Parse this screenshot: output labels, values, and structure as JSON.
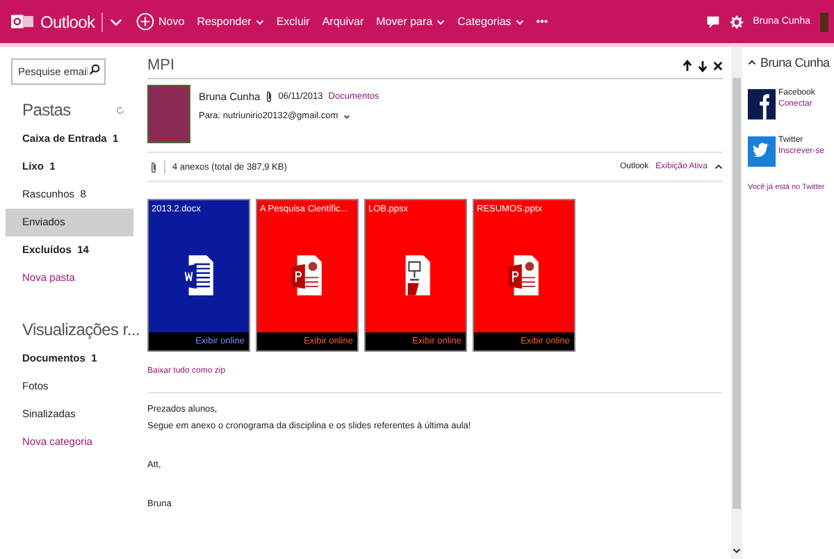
{
  "app": {
    "name": "Outlook"
  },
  "toolbar": {
    "new_label": "Novo",
    "actions": [
      {
        "label": "Responder",
        "dropdown": true
      },
      {
        "label": "Excluir",
        "dropdown": false
      },
      {
        "label": "Arquivar",
        "dropdown": false
      },
      {
        "label": "Mover para",
        "dropdown": true
      },
      {
        "label": "Categorias",
        "dropdown": true
      },
      {
        "label": "•••",
        "dropdown": false
      }
    ]
  },
  "user": {
    "name": "Bruna Cunha"
  },
  "search": {
    "placeholder": "Pesquise email"
  },
  "folders": {
    "title": "Pastas",
    "items": [
      {
        "label": "Caixa de Entrada",
        "count": "1",
        "unread": true,
        "selected": false
      },
      {
        "label": "Lixo",
        "count": "1",
        "unread": true,
        "selected": false
      },
      {
        "label": "Rascunhos",
        "count": "8",
        "unread": false,
        "selected": false
      },
      {
        "label": "Enviados",
        "unread": false,
        "selected": true
      },
      {
        "label": "Excluídos",
        "count": "14",
        "unread": true,
        "selected": false
      }
    ],
    "new_link": "Nova pasta"
  },
  "views": {
    "title": "Visualizações r...",
    "items": [
      {
        "label": "Documentos",
        "count": "1",
        "unread": true,
        "selected": false
      },
      {
        "label": "Fotos",
        "unread": false,
        "selected": false
      },
      {
        "label": "Sinalizadas",
        "unread": false,
        "selected": false
      }
    ],
    "new_link": "Nova categoria"
  },
  "message": {
    "subject": "MPI",
    "sender": "Bruna Cunha",
    "date": "06/11/2013",
    "category": "Documentos",
    "to": "Para: nutriunirio20132@gmail.com",
    "attachments_summary": "4 anexos (total de 387,9 KB)",
    "view_prefix": "Outlook",
    "view_link": "Exibição Ativa",
    "attachments": [
      {
        "name": "2013.2.docx",
        "kind": "word",
        "color": "#0a1a9e",
        "action": "Exibir online"
      },
      {
        "name": "A Pesquisa Científic...",
        "kind": "powerpoint",
        "color": "#ff0000",
        "action": "Exibir online"
      },
      {
        "name": "LOB.ppsx",
        "kind": "slideshow",
        "color": "#ff0000",
        "action": "Exibir online"
      },
      {
        "name": "RESUMOS.pptx",
        "kind": "powerpoint",
        "color": "#ff0000",
        "action": "Exibir online"
      }
    ],
    "download_all": "Baixar tudo como zip",
    "body": [
      {
        "lines": [
          "Prezados alunos,",
          "Segue em anexo o cronograma da disciplina e os slides referentes à última aula!"
        ]
      },
      {
        "lines": [
          "Att,"
        ]
      },
      {
        "lines": [
          "Bruna"
        ]
      }
    ]
  },
  "people": {
    "name": "Bruna Cunha",
    "networks": [
      {
        "kind": "facebook",
        "name": "Facebook",
        "action": "Conectar"
      },
      {
        "kind": "twitter",
        "name": "Twitter",
        "action": "Inscrever-se"
      }
    ],
    "note": "Você já está no Twitter"
  }
}
